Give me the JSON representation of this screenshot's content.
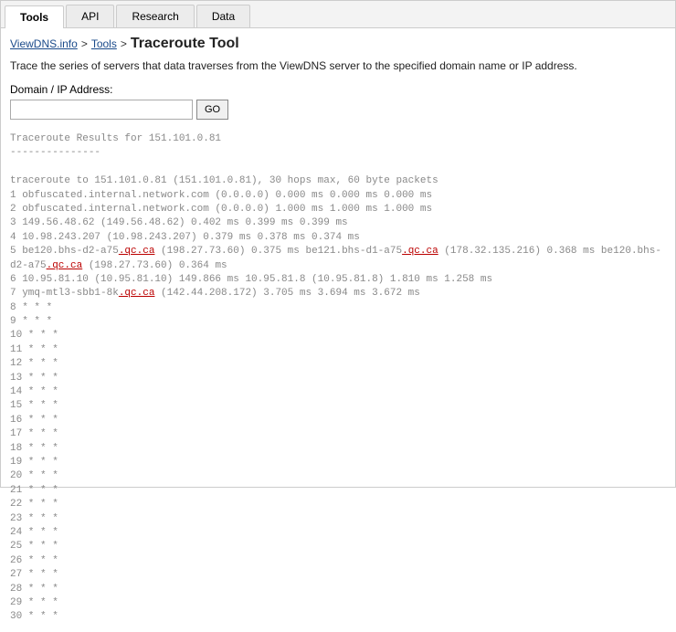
{
  "tabs": [
    "Tools",
    "API",
    "Research",
    "Data"
  ],
  "active_tab": 0,
  "breadcrumb": {
    "root": "ViewDNS.info",
    "section": "Tools",
    "current": "Traceroute Tool"
  },
  "description": "Trace the series of servers that data traverses from the ViewDNS server to the specified domain name or IP address.",
  "form": {
    "label": "Domain / IP Address:",
    "value": "",
    "button": "GO"
  },
  "results": {
    "header": "Traceroute Results for 151.101.0.81",
    "intro": "traceroute to 151.101.0.81 (151.101.0.81), 30 hops max, 60 byte packets",
    "hops": [
      "1 obfuscated.internal.network.com (0.0.0.0) 0.000 ms 0.000 ms 0.000 ms",
      "2 obfuscated.internal.network.com (0.0.0.0) 1.000 ms 1.000 ms 1.000 ms",
      "3 149.56.48.62 (149.56.48.62) 0.402 ms 0.399 ms 0.399 ms",
      "4 10.98.243.207 (10.98.243.207) 0.379 ms 0.378 ms 0.374 ms",
      "5 be120.bhs-d2-a75.qc.ca (198.27.73.60) 0.375 ms be121.bhs-d1-a75.qc.ca (178.32.135.216) 0.368 ms be120.bhs-d2-a75.qc.ca (198.27.73.60) 0.364 ms",
      "6 10.95.81.10 (10.95.81.10) 149.866 ms 10.95.81.8 (10.95.81.8) 1.810 ms 1.258 ms",
      "7 ymq-mtl3-sbb1-8k.qc.ca (142.44.208.172) 3.705 ms 3.694 ms 3.672 ms",
      "8 * * *",
      "9 * * *",
      "10 * * *",
      "11 * * *",
      "12 * * *",
      "13 * * *",
      "14 * * *",
      "15 * * *",
      "16 * * *",
      "17 * * *",
      "18 * * *",
      "19 * * *",
      "20 * * *",
      "21 * * *",
      "22 * * *",
      "23 * * *",
      "24 * * *",
      "25 * * *",
      "26 * * *",
      "27 * * *",
      "28 * * *",
      "29 * * *",
      "30 * * *"
    ]
  }
}
